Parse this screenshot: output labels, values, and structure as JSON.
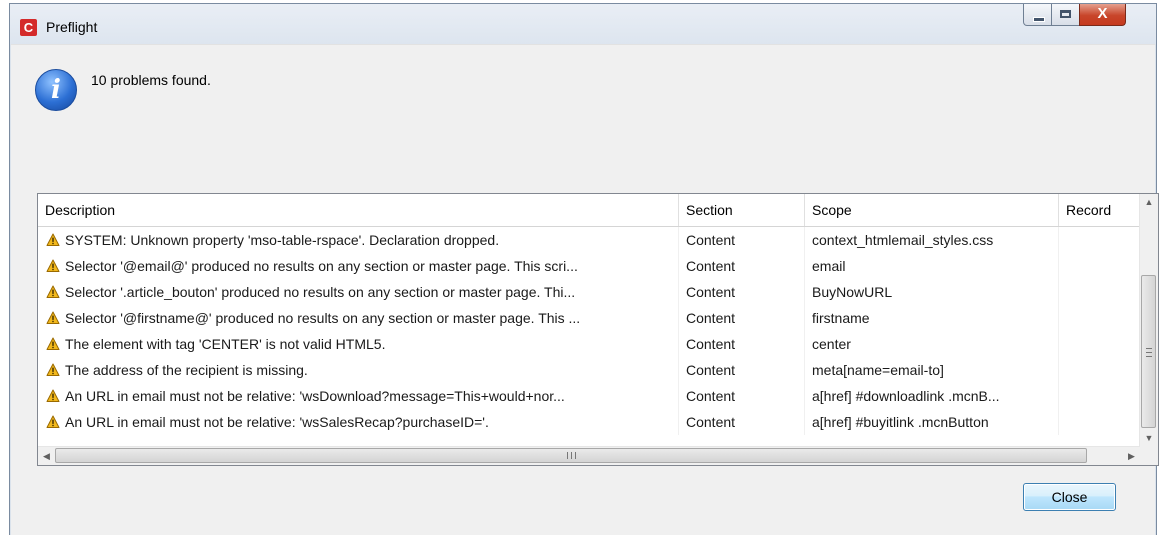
{
  "window": {
    "title": "Preflight",
    "app_icon_letter": "C",
    "controls": {
      "minimize": "",
      "maximize": "",
      "close": "X"
    }
  },
  "message": "10 problems found.",
  "table": {
    "columns": [
      "Description",
      "Section",
      "Scope",
      "Record"
    ],
    "rows": [
      {
        "description": "SYSTEM: Unknown property 'mso-table-rspace'.  Declaration dropped.",
        "section": "Content",
        "scope": "context_htmlemail_styles.css",
        "record": ""
      },
      {
        "description": "Selector '@email@' produced no results on any section or master page. This scri...",
        "section": "Content",
        "scope": "email",
        "record": ""
      },
      {
        "description": "Selector '.article_bouton' produced no results on any section or master page. Thi...",
        "section": "Content",
        "scope": "BuyNowURL",
        "record": ""
      },
      {
        "description": "Selector '@firstname@' produced no results on any section or master page. This ...",
        "section": "Content",
        "scope": "firstname",
        "record": ""
      },
      {
        "description": "The element with tag 'CENTER' is not valid HTML5.",
        "section": "Content",
        "scope": "center",
        "record": ""
      },
      {
        "description": "The address of the recipient is missing.",
        "section": "Content",
        "scope": "meta[name=email-to]",
        "record": ""
      },
      {
        "description": "An URL in email must not be relative: 'wsDownload?message=This+would+nor...",
        "section": "Content",
        "scope": "a[href] #downloadlink .mcnB...",
        "record": ""
      },
      {
        "description": "An URL in email must not be relative: 'wsSalesRecap?purchaseID='.",
        "section": "Content",
        "scope": "a[href] #buyitlink .mcnButton",
        "record": ""
      }
    ],
    "row_icon": "warning-icon",
    "scrollbar": {
      "h_grip": "III",
      "v_grip": "≡"
    }
  },
  "buttons": {
    "close": "Close"
  },
  "colors": {
    "warning": "#f2b81c",
    "accent": "#3c7fb1",
    "close_red": "#c8452a"
  }
}
